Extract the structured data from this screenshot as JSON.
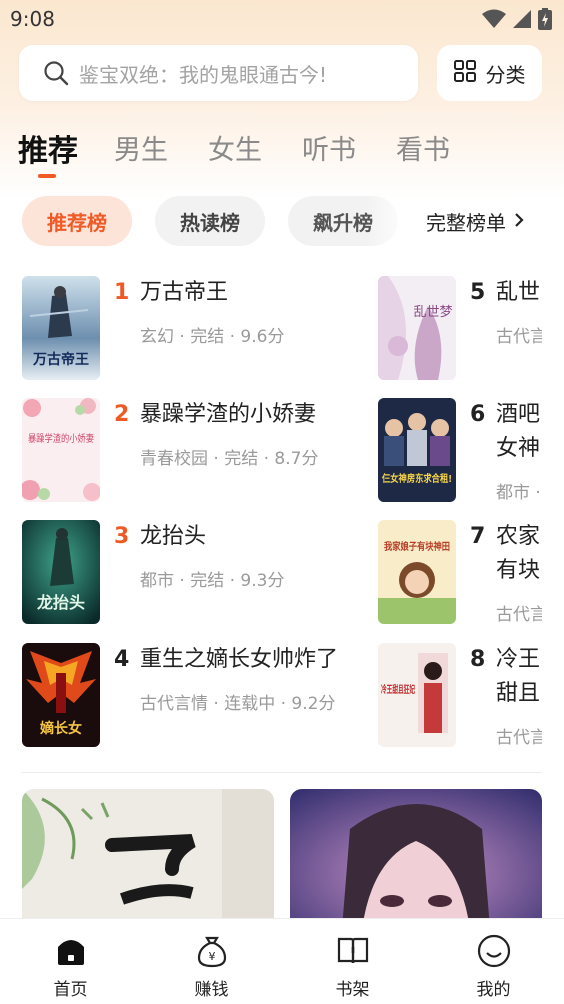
{
  "status_bar": {
    "time": "9:08"
  },
  "search": {
    "placeholder": "鉴宝双绝：我的鬼眼通古今!"
  },
  "category_button": {
    "label": "分类"
  },
  "tabs": [
    {
      "label": "推荐",
      "active": true
    },
    {
      "label": "男生",
      "active": false
    },
    {
      "label": "女生",
      "active": false
    },
    {
      "label": "听书",
      "active": false
    },
    {
      "label": "看书",
      "active": false
    }
  ],
  "chips": [
    {
      "label": "推荐榜",
      "active": true
    },
    {
      "label": "热读榜",
      "active": false
    },
    {
      "label": "飙升榜",
      "active": false
    }
  ],
  "full_list": {
    "label": "完整榜单"
  },
  "ranking": [
    {
      "rank": "1",
      "title": "万古帝王",
      "meta": "玄幻 · 完结 · 9.6分"
    },
    {
      "rank": "2",
      "title": "暴躁学渣的小娇妻",
      "meta": "青春校园 · 完结 · 8.7分"
    },
    {
      "rank": "3",
      "title": "龙抬头",
      "meta": "都市 · 完结 · 9.3分"
    },
    {
      "rank": "4",
      "title": "重生之嫡长女帅炸了",
      "meta": "古代言情 · 连载中 · 9.2分"
    },
    {
      "rank": "5",
      "title": "乱世",
      "meta": "古代言"
    },
    {
      "rank": "6",
      "title": "酒吧女神",
      "meta": "都市 ·"
    },
    {
      "rank": "7",
      "title": "农家有块",
      "meta": "古代言"
    },
    {
      "rank": "8",
      "title": "冷王甜且",
      "meta": "古代言"
    }
  ],
  "cover_texts": {
    "c1": "万古帝王",
    "c2": "暴躁学渣的小娇妻",
    "c3": "龙抬头",
    "c4": "嫡长女",
    "c5": "乱世梦",
    "c6": "仨女神房东求合租!",
    "c7": "我家娘子有块神田",
    "c8": "冷王甜且狂妃"
  },
  "bottom_nav": [
    {
      "label": "首页",
      "icon": "home-icon",
      "active": true
    },
    {
      "label": "赚钱",
      "icon": "money-bag-icon",
      "active": false
    },
    {
      "label": "书架",
      "icon": "bookshelf-icon",
      "active": false
    },
    {
      "label": "我的",
      "icon": "profile-icon",
      "active": false
    }
  ],
  "colors": {
    "accent": "#ef5a26",
    "chip_active_bg": "#fde4d8",
    "top_gradient": "#fbe7cf"
  }
}
